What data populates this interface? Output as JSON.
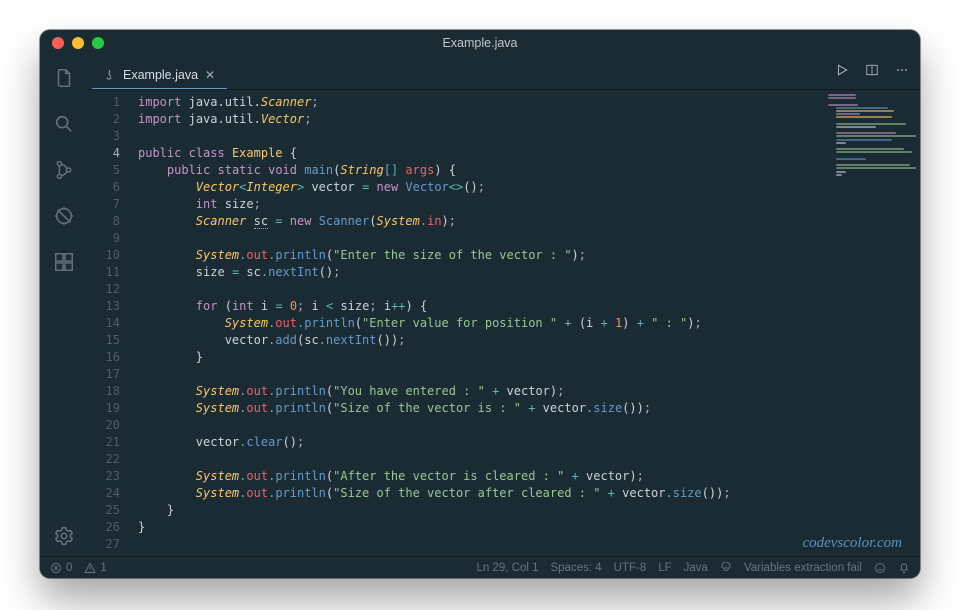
{
  "window": {
    "title": "Example.java"
  },
  "tab": {
    "label": "Example.java"
  },
  "watermark": "codevscolor.com",
  "gutter": {
    "lines": [
      "1",
      "2",
      "3",
      "4",
      "5",
      "6",
      "7",
      "8",
      "9",
      "10",
      "11",
      "12",
      "13",
      "14",
      "15",
      "16",
      "17",
      "18",
      "19",
      "20",
      "21",
      "22",
      "23",
      "24",
      "25",
      "26",
      "27"
    ],
    "current": 4
  },
  "statusbar": {
    "errors": "0",
    "warnings": "1",
    "position": "Ln 29, Col 1",
    "spaces": "Spaces: 4",
    "encoding": "UTF-8",
    "eol": "LF",
    "language": "Java",
    "extra": "Variables extraction fail"
  },
  "code": {
    "l1": {
      "kw": "import",
      "pkg": "java.util.",
      "cls": "Scanner"
    },
    "l2": {
      "kw": "import",
      "pkg": "java.util.",
      "cls": "Vector"
    },
    "l4": {
      "kw1": "public",
      "kw2": "class",
      "cls": "Example"
    },
    "l5": {
      "kw1": "public",
      "kw2": "static",
      "kw3": "void",
      "fn": "main",
      "ptype": "String",
      "arr": "[]",
      "pname": "args"
    },
    "l6": {
      "gtype": "Vector",
      "gsub": "Integer",
      "var": "vector",
      "kw": "new",
      "ctor": "Vector"
    },
    "l7": {
      "type": "int",
      "var": "size"
    },
    "l8": {
      "type": "Scanner",
      "var": "sc",
      "kw": "new",
      "ctor": "Scanner",
      "obj": "System",
      "field": "in"
    },
    "l10": {
      "obj": "System",
      "field": "out",
      "fn": "println",
      "str": "\"Enter the size of the vector : \""
    },
    "l11": {
      "lhs": "size",
      "obj": "sc",
      "fn": "nextInt"
    },
    "l13": {
      "kw": "for",
      "type": "int",
      "var": "i",
      "init": "0",
      "cond_lhs": "i",
      "cond_rhs": "size",
      "inc": "i"
    },
    "l14": {
      "obj": "System",
      "field": "out",
      "fn": "println",
      "s1": "\"Enter value for position \"",
      "mid_l": "i",
      "mid_r": "1",
      "s2": "\" : \""
    },
    "l15": {
      "obj": "vector",
      "fn": "add",
      "inner_obj": "sc",
      "inner_fn": "nextInt"
    },
    "l18": {
      "obj": "System",
      "field": "out",
      "fn": "println",
      "str": "\"You have entered : \"",
      "rhs": "vector"
    },
    "l19": {
      "obj": "System",
      "field": "out",
      "fn": "println",
      "str": "\"Size of the vector is : \"",
      "rhs_obj": "vector",
      "rhs_fn": "size"
    },
    "l21": {
      "obj": "vector",
      "fn": "clear"
    },
    "l23": {
      "obj": "System",
      "field": "out",
      "fn": "println",
      "str": "\"After the vector is cleared : \"",
      "rhs": "vector"
    },
    "l24": {
      "obj": "System",
      "field": "out",
      "fn": "println",
      "str": "\"Size of the vector after cleared : \"",
      "rhs_obj": "vector",
      "rhs_fn": "size"
    }
  }
}
